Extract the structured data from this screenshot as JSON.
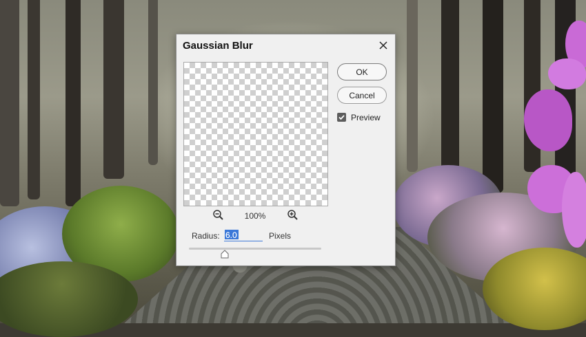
{
  "dialog": {
    "title": "Gaussian Blur",
    "ok_label": "OK",
    "cancel_label": "Cancel",
    "preview_checkbox": {
      "label": "Preview",
      "checked": true
    },
    "zoom_level": "100%",
    "radius": {
      "label": "Radius:",
      "value": "6.0",
      "unit": "Pixels"
    },
    "slider_fraction": 0.27
  },
  "icons": {
    "close": "close-icon",
    "zoom_out": "zoom-out-icon",
    "zoom_in": "zoom-in-icon",
    "check": "checkmark-icon"
  },
  "colors": {
    "dialog_bg": "#f0f0f0",
    "selection": "#3b78d8",
    "checkbox": "#5c5c5c"
  }
}
